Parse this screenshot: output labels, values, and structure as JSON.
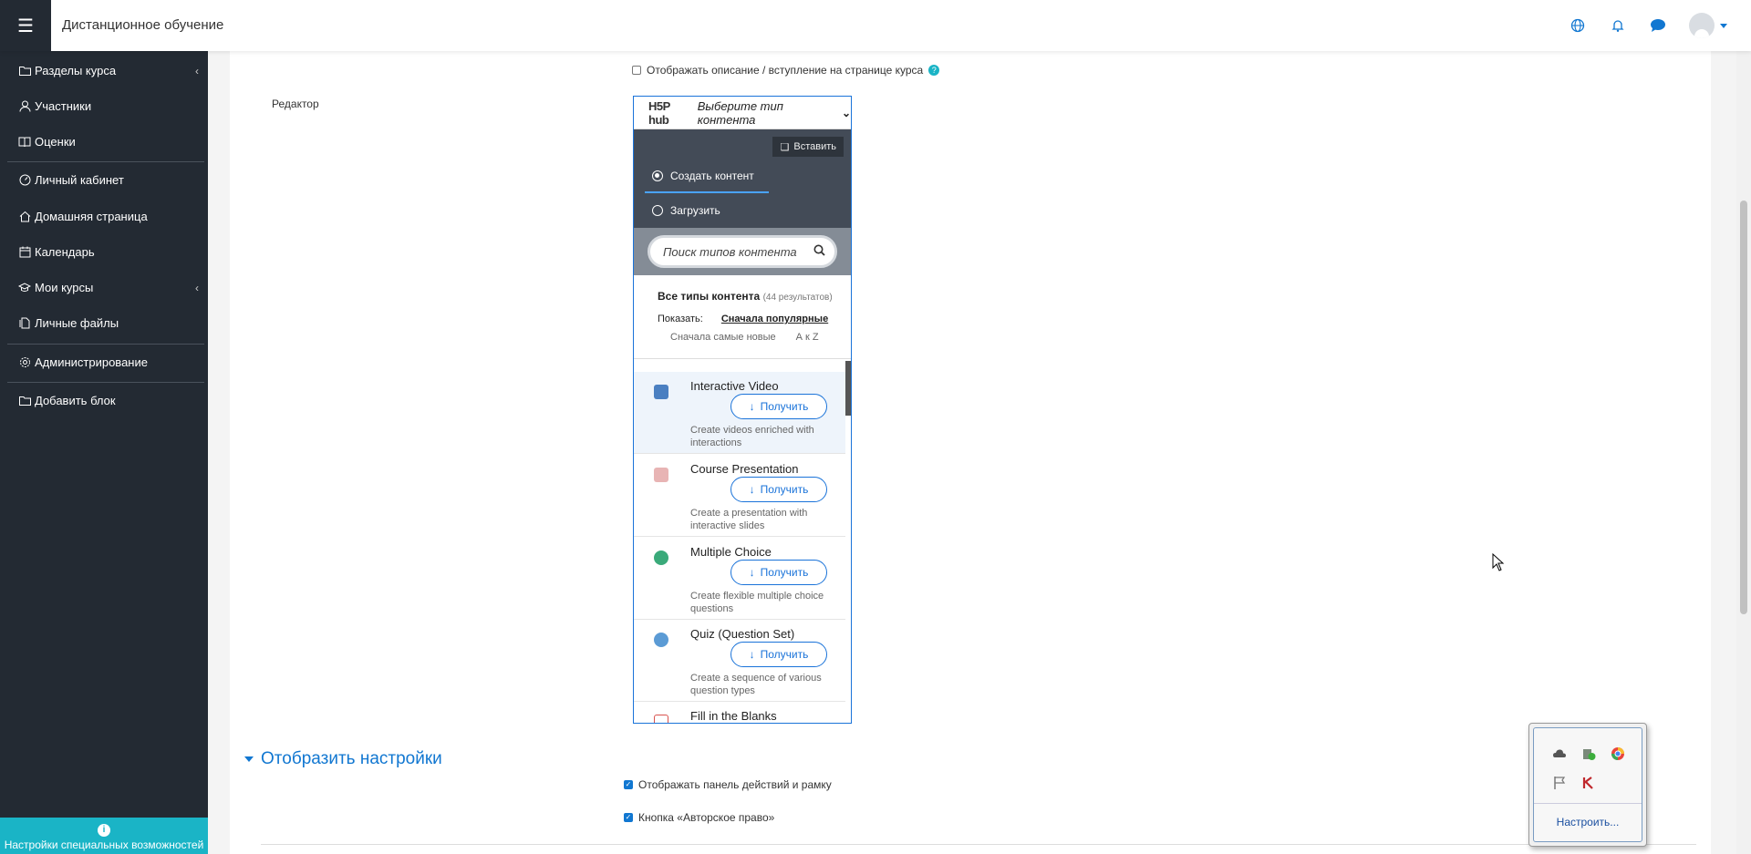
{
  "topbar": {
    "site_title": "Дистанционное обучение",
    "icons": [
      "language-icon",
      "bell-icon",
      "chat-icon",
      "user-avatar"
    ]
  },
  "sidebar": {
    "items": [
      {
        "label": "Разделы курса",
        "icon": "folder-icon",
        "expandable": true
      },
      {
        "label": "Участники",
        "icon": "users-icon"
      },
      {
        "label": "Оценки",
        "icon": "book-icon"
      },
      {
        "label": "Личный кабинет",
        "icon": "dashboard-icon"
      },
      {
        "label": "Домашняя страница",
        "icon": "home-icon"
      },
      {
        "label": "Календарь",
        "icon": "calendar-icon"
      },
      {
        "label": "Мои курсы",
        "icon": "graduation-cap-icon",
        "expandable": true
      },
      {
        "label": "Личные файлы",
        "icon": "files-icon"
      },
      {
        "label": "Администрирование",
        "icon": "gear-icon"
      },
      {
        "label": "Добавить блок",
        "icon": "folder-plus-icon"
      }
    ],
    "accessibility_label": "Настройки специальных возможностей"
  },
  "form": {
    "show_description_label": "Отображать описание / вступление на странице курса",
    "editor_label": "Редактор",
    "display_section_title": "Отобразить настройки",
    "option_actionbar_label": "Отображать панель действий и рамку",
    "option_copyright_label": "Кнопка «Авторское право»"
  },
  "hub": {
    "logo": "H5P hub",
    "select_type": "Выберите тип контента",
    "paste_label": "Вставить",
    "tab_create": "Создать контент",
    "tab_upload": "Загрузить",
    "search_placeholder": "Поиск типов контента",
    "all_types_label": "Все типы контента",
    "results_count": "(44 результатов)",
    "show_label": "Показать:",
    "sort_popular": "Сначала популярные",
    "sort_newest": "Сначала самые новые",
    "sort_az": "А к Z",
    "get_label": "Получить",
    "items": [
      {
        "title": "Interactive Video",
        "desc": "Create videos enriched with interactions",
        "color": "#4a7fc1"
      },
      {
        "title": "Course Presentation",
        "desc": "Create a presentation with interactive slides",
        "color": "#e07a7a"
      },
      {
        "title": "Multiple Choice",
        "desc": "Create flexible multiple choice questions",
        "color": "#3aaa7a"
      },
      {
        "title": "Quiz (Question Set)",
        "desc": "Create a sequence of various question types",
        "color": "#5b9bd5"
      },
      {
        "title": "Fill in the Blanks",
        "desc": "",
        "color": "#d9534f"
      }
    ]
  },
  "tray": {
    "icons": [
      "cloud-sync-icon",
      "security-shield-icon",
      "browser-icon",
      "flag-icon",
      "antivirus-icon"
    ],
    "customize_label": "Настроить..."
  }
}
